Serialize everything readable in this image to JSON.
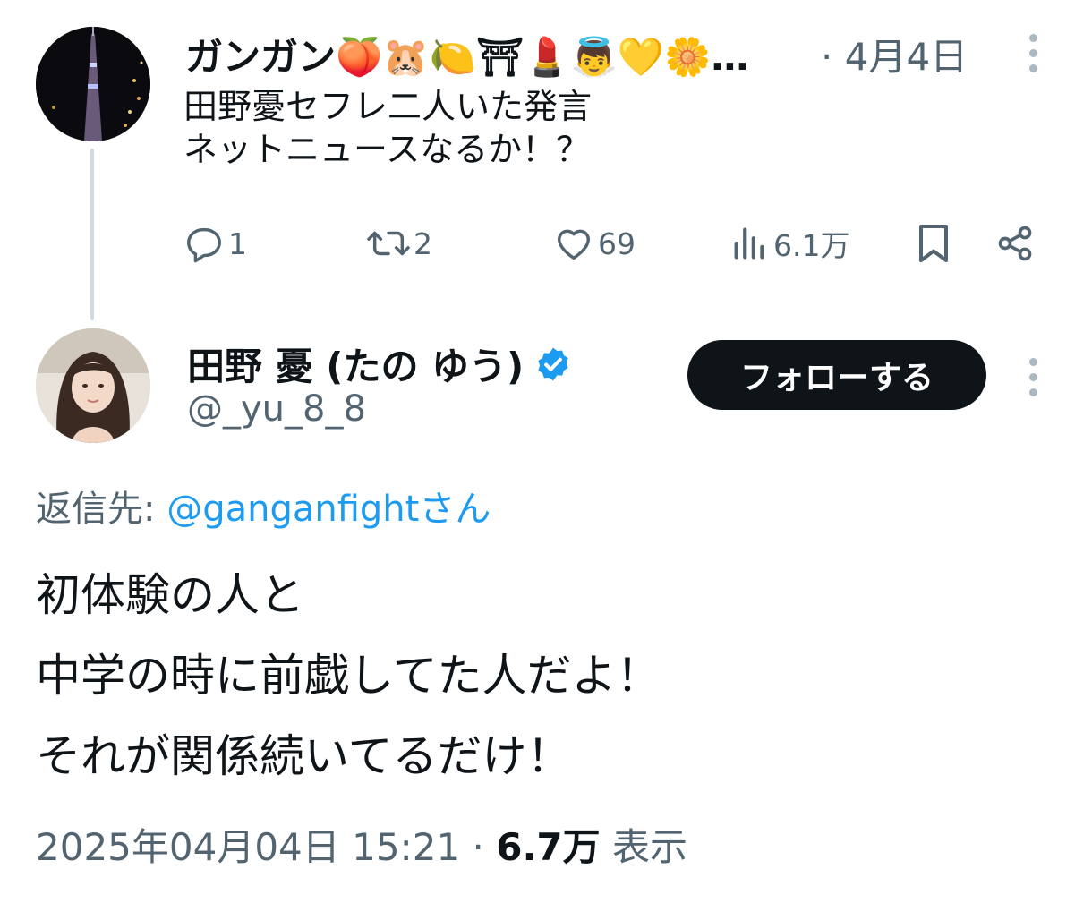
{
  "parent_tweet": {
    "display_name": "ガンガン🍑🐹🍋⛩💄👼💛🌼…",
    "separator": "·",
    "date": "4月4日",
    "body_lines": "田野憂セフレ二人いた発言\nネットニュースなるか！？",
    "actions": {
      "replies": "1",
      "retweets": "2",
      "likes": "69",
      "views": "6.1万"
    }
  },
  "main_tweet": {
    "display_name": "田野 憂 (たの ゆう)",
    "handle": "@_yu_8_8",
    "follow_label": "フォローする",
    "reply_to_prefix": "返信先: ",
    "reply_to_user": "@ganganfightさん",
    "body_lines": "初体験の人と\n中学の時に前戯してた人だよ！\nそれが関係続いてるだけ！",
    "timestamp": "2025年04月04日 15:21",
    "separator": "·",
    "views_count": "6.7万",
    "views_label": "表示"
  },
  "colors": {
    "secondary_text": "#536471",
    "link": "#1d9bf0",
    "verified": "#1d9bf0",
    "button_bg": "#0f1419",
    "thread_line": "#cfd9de"
  },
  "icons": [
    "reply-icon",
    "retweet-icon",
    "like-icon",
    "views-icon",
    "bookmark-icon",
    "share-icon",
    "more-icon",
    "verified-badge-icon"
  ]
}
